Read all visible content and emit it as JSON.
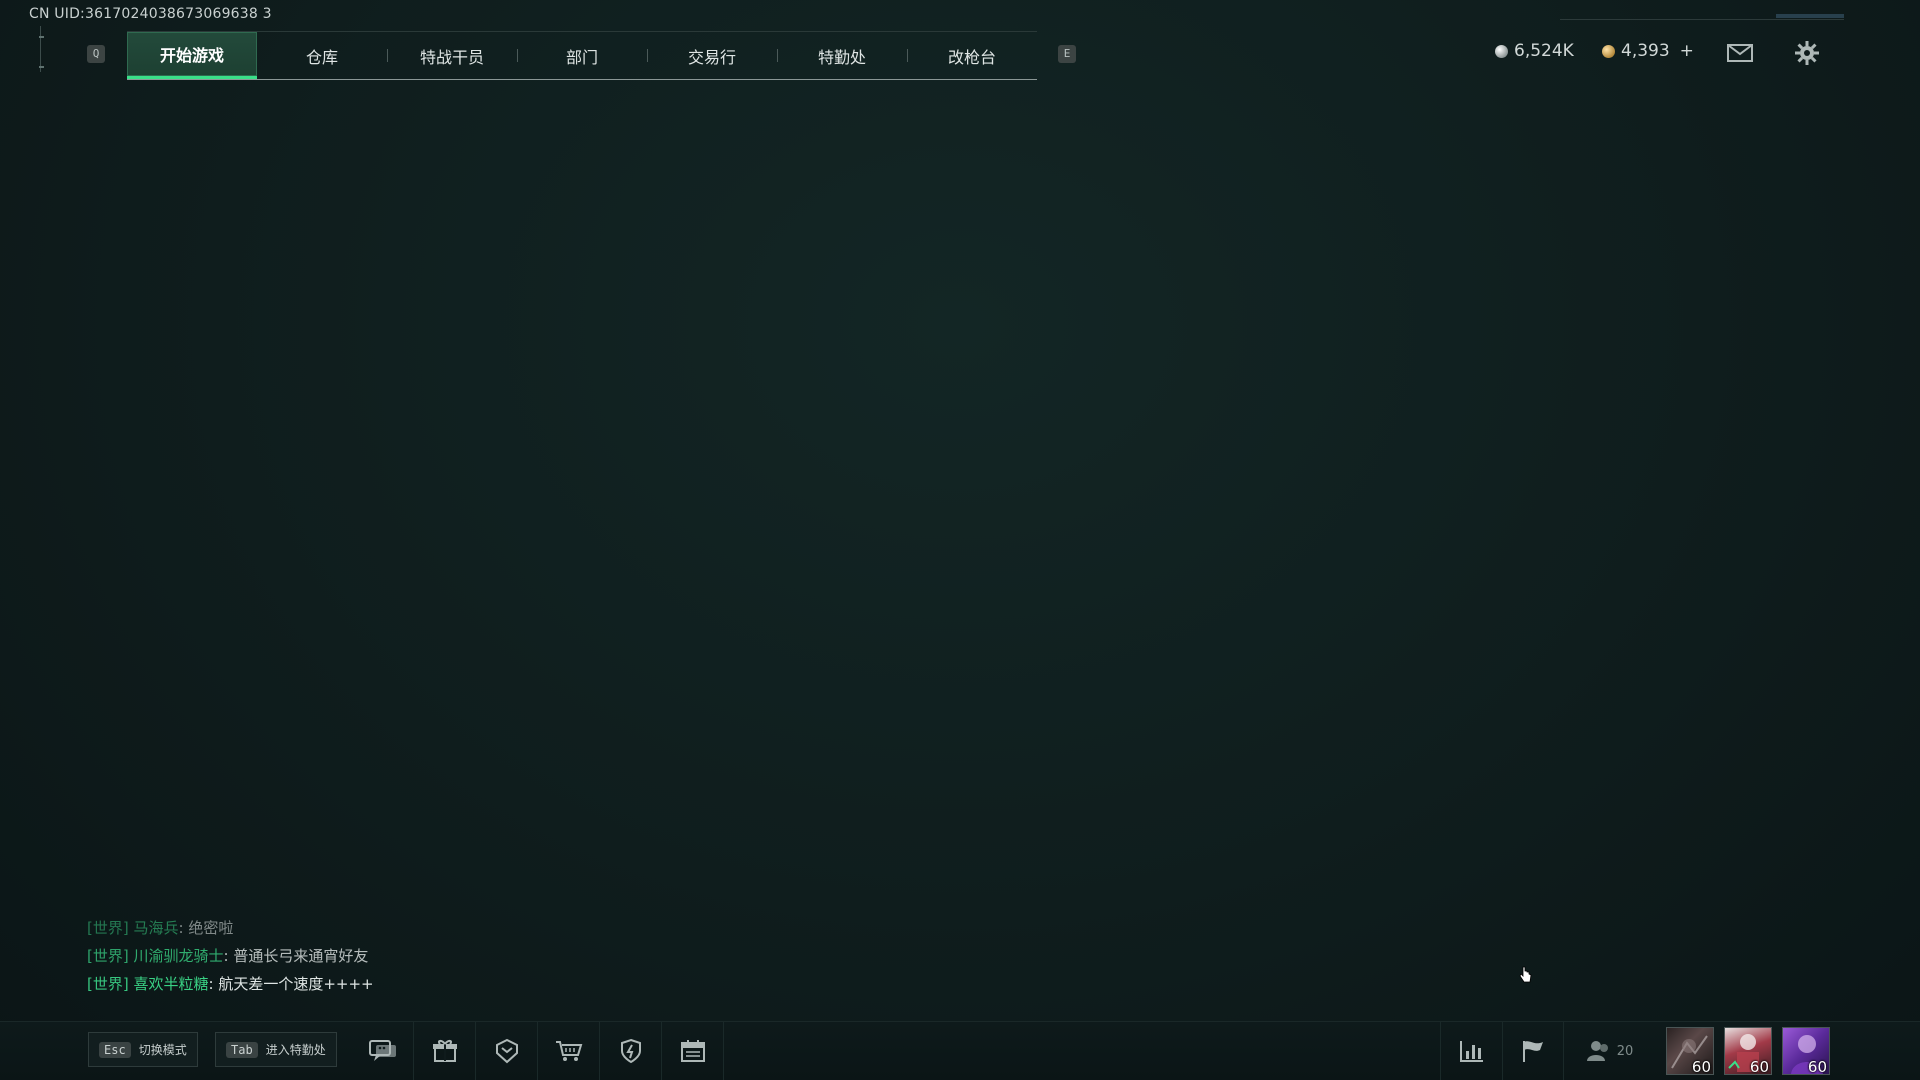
{
  "uid_label": "CN UID:3617024038673069638 3",
  "top_nav": {
    "prev_key": "Q",
    "next_key": "E",
    "tabs": [
      {
        "label": "开始游戏",
        "active": true
      },
      {
        "label": "仓库",
        "active": false
      },
      {
        "label": "特战干员",
        "active": false
      },
      {
        "label": "部门",
        "active": false
      },
      {
        "label": "交易行",
        "active": false
      },
      {
        "label": "特勤处",
        "active": false
      },
      {
        "label": "改枪台",
        "active": false
      }
    ]
  },
  "currencies": {
    "silver": "6,524K",
    "gold": "4,393",
    "gold_add": "+"
  },
  "top_icons": [
    "mail-icon",
    "gear-icon"
  ],
  "chat": [
    {
      "channel": "[世界]",
      "user": "马海兵",
      "sep": ": ",
      "message": "绝密啦"
    },
    {
      "channel": "[世界]",
      "user": "川渝驯龙骑士",
      "sep": ": ",
      "message": "普通长弓来通宵好友"
    },
    {
      "channel": "[世界]",
      "user": "喜欢半粒糖",
      "sep": ": ",
      "message": "航天差一个速度++++"
    }
  ],
  "bottom_bar": {
    "esc_key": "Esc",
    "esc_label": "切换模式",
    "tab_key": "Tab",
    "tab_label": "进入特勤处",
    "icons": [
      "chat-icon",
      "gift-box-icon",
      "badge-icon",
      "cart-icon",
      "shield-icon",
      "calendar-icon"
    ],
    "right_icons": [
      "stats-icon",
      "flag-icon"
    ],
    "friend_count": "20"
  },
  "squad_avatars": [
    {
      "level": "60",
      "color": "#4a3a3a"
    },
    {
      "level": "60",
      "color": "#8a3c44"
    },
    {
      "level": "60",
      "color": "#6a3aa8"
    }
  ],
  "colors": {
    "accent_green": "#39e089",
    "background": "#0f1b1c"
  }
}
